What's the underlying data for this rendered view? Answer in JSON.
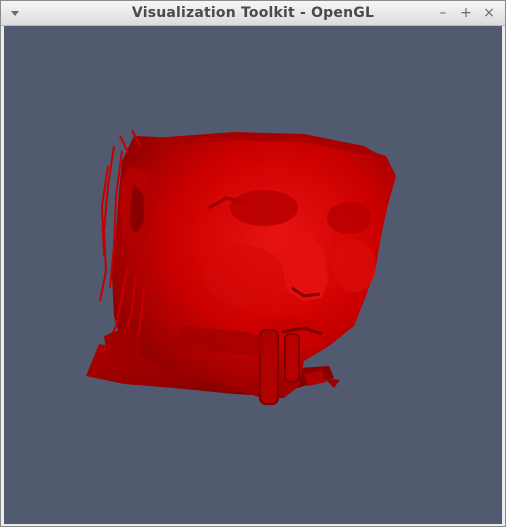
{
  "window": {
    "title": "Visualization Toolkit - OpenGL",
    "controls": {
      "minimize": "–",
      "maximize": "+",
      "close": "×"
    }
  },
  "viewport": {
    "background_color": "#525a70",
    "model_color": "#cc0000",
    "model_highlight": "#e01010",
    "model_shadow": "#8a0000"
  }
}
